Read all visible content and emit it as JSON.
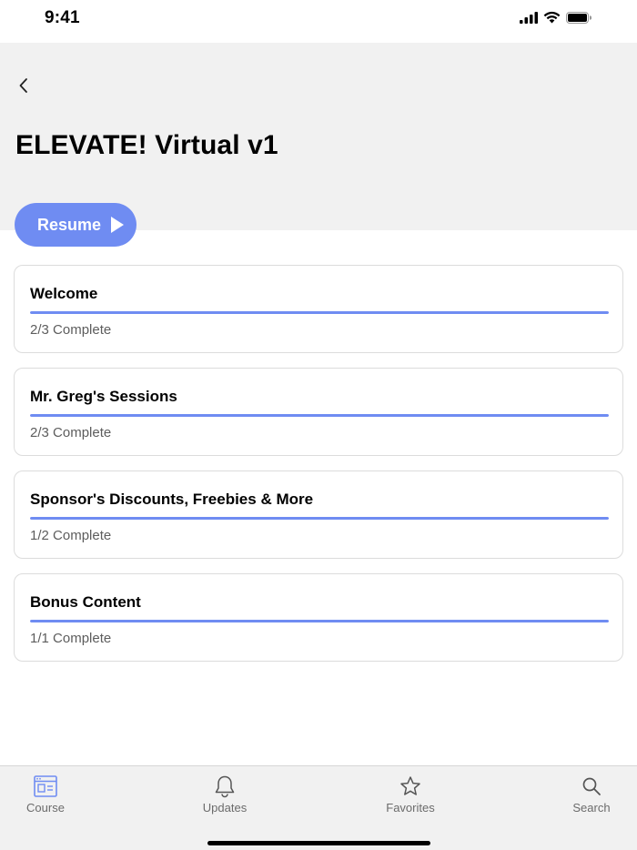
{
  "status_bar": {
    "time": "9:41"
  },
  "header": {
    "title": "ELEVATE! Virtual v1"
  },
  "resume": {
    "label": "Resume"
  },
  "modules": [
    {
      "title": "Welcome",
      "status": "2/3 Complete",
      "progress": 1.0
    },
    {
      "title": "Mr. Greg's Sessions",
      "status": "2/3 Complete",
      "progress": 1.0
    },
    {
      "title": "Sponsor's Discounts, Freebies & More",
      "status": "1/2 Complete",
      "progress": 1.0
    },
    {
      "title": "Bonus Content",
      "status": "1/1 Complete",
      "progress": 1.0
    }
  ],
  "tabs": [
    {
      "label": "Course",
      "icon": "course-icon",
      "active": true
    },
    {
      "label": "Updates",
      "icon": "bell-icon",
      "active": false
    },
    {
      "label": "Favorites",
      "icon": "star-icon",
      "active": false
    },
    {
      "label": "Search",
      "icon": "search-icon",
      "active": false
    }
  ],
  "colors": {
    "accent": "#6f8cf2",
    "header_bg": "#f1f1f1",
    "tab_bar_bg": "#f1f1f1"
  }
}
